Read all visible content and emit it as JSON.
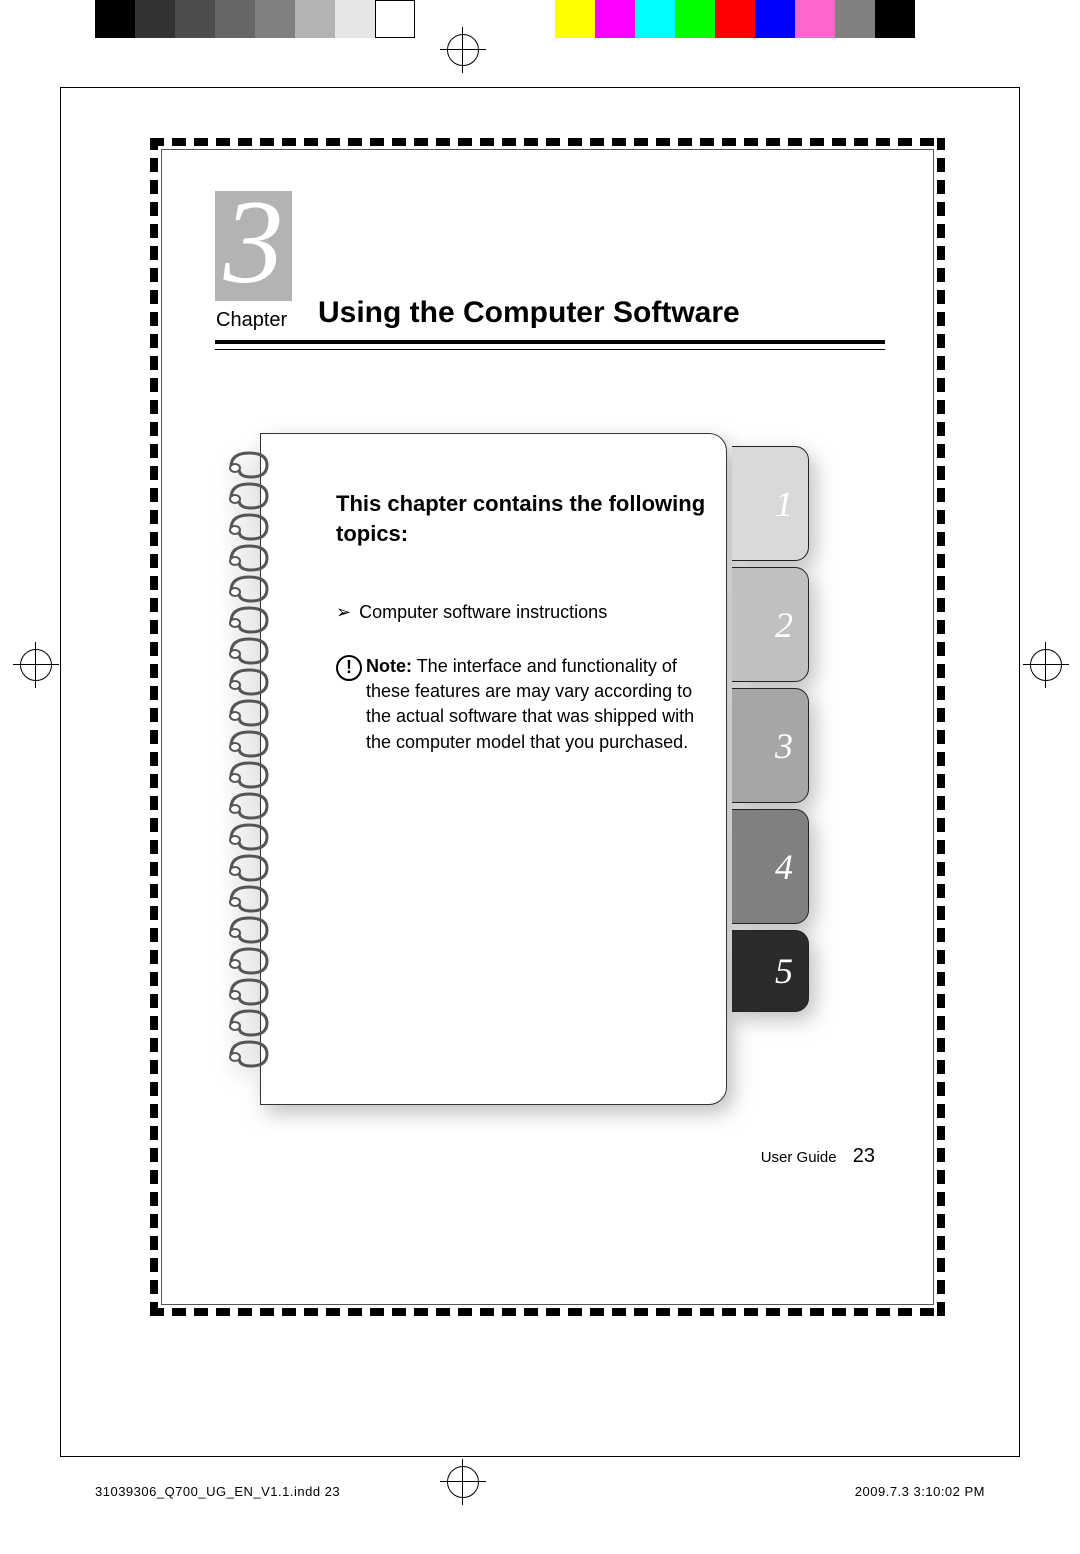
{
  "chapter": {
    "number": "3",
    "label": "Chapter",
    "title": "Using the Computer Software"
  },
  "intro_heading": "This chapter contains the following topics:",
  "topics": [
    "Computer software instructions"
  ],
  "note": {
    "label": "Note:",
    "body": "The interface and functionality of these features are may vary according to the actual software that was shipped with the computer model that you purchased."
  },
  "side_tabs": [
    "1",
    "2",
    "3",
    "4",
    "5"
  ],
  "tab_colors": [
    "#d9d9d9",
    "#c0c0c0",
    "#a6a6a6",
    "#808080",
    "#2b2b2b"
  ],
  "footer": {
    "doc_label": "User Guide",
    "page_number": "23"
  },
  "slug": {
    "filename": "31039306_Q700_UG_EN_V1.1.indd   23",
    "timestamp": "2009.7.3   3:10:02 PM"
  },
  "print_bars_left": [
    "#000000",
    "#333333",
    "#4d4d4d",
    "#666666",
    "#808080",
    "#b3b3b3",
    "#e6e6e6"
  ],
  "print_bars_right": [
    "#ffff00",
    "#ff00ff",
    "#00ffff",
    "#00ff00",
    "#ff0000",
    "#0000ff",
    "#ff66cc",
    "#808080",
    "#000000"
  ]
}
